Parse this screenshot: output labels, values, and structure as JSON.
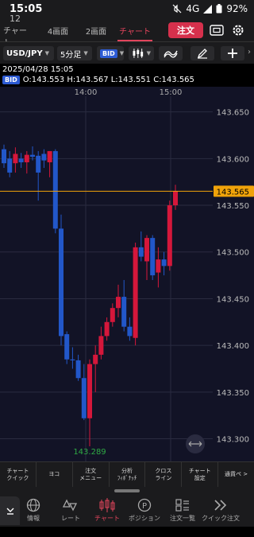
{
  "status": {
    "time": "15:05",
    "network": "4G",
    "battery": "92%"
  },
  "tabs": [
    {
      "num": "12",
      "label": "チャート"
    },
    {
      "label": "4画面"
    },
    {
      "label": "2画面"
    },
    {
      "label": "チャート"
    }
  ],
  "header": {
    "order_label": "注文"
  },
  "toolbar": {
    "pair": "USD/JPY",
    "timeframe": "5分足",
    "price_type": "BID"
  },
  "info": {
    "datetime": "2025/04/28 15:05",
    "badge": "BID",
    "ohlc": "O:143.553 H:143.567 L:143.551 C:143.565"
  },
  "chart_data": {
    "type": "candlestick",
    "time_labels": [
      "14:00",
      "15:00"
    ],
    "y_ticks": [
      "143.650",
      "143.600",
      "143.550",
      "143.500",
      "143.450",
      "143.400",
      "143.350",
      "143.300"
    ],
    "ylim": [
      143.286,
      143.665
    ],
    "current_price": "143.565",
    "low_marker": "143.289",
    "colors": {
      "up": "#d5173b",
      "down": "#2257c9",
      "price_line": "#f0a30a",
      "low_marker": "#2faa44"
    },
    "candles": [
      [
        143.61,
        143.615,
        143.59,
        143.595
      ],
      [
        143.6,
        143.608,
        143.58,
        143.585
      ],
      [
        143.595,
        143.612,
        143.585,
        143.605
      ],
      [
        143.6,
        143.606,
        143.59,
        143.596
      ],
      [
        143.596,
        143.608,
        143.584,
        143.604
      ],
      [
        143.604,
        143.613,
        143.598,
        143.602
      ],
      [
        143.603,
        143.608,
        143.555,
        143.585
      ],
      [
        143.605,
        143.61,
        143.59,
        143.598
      ],
      [
        143.596,
        143.608,
        143.58,
        143.608
      ],
      [
        143.608,
        143.61,
        143.52,
        143.525
      ],
      [
        143.525,
        143.54,
        143.4,
        143.41
      ],
      [
        143.412,
        143.415,
        143.38,
        143.385
      ],
      [
        143.385,
        143.398,
        143.375,
        143.384
      ],
      [
        143.384,
        143.39,
        143.362,
        143.365
      ],
      [
        143.365,
        143.38,
        143.32,
        143.322
      ],
      [
        143.322,
        143.385,
        143.292,
        143.38
      ],
      [
        143.38,
        143.4,
        143.35,
        143.39
      ],
      [
        143.39,
        143.42,
        143.385,
        143.41
      ],
      [
        143.41,
        143.43,
        143.405,
        143.425
      ],
      [
        143.425,
        143.445,
        143.42,
        143.44
      ],
      [
        143.44,
        143.465,
        143.43,
        143.452
      ],
      [
        143.452,
        143.47,
        143.415,
        143.42
      ],
      [
        143.42,
        143.43,
        143.405,
        143.41
      ],
      [
        143.408,
        143.51,
        143.4,
        143.505
      ],
      [
        143.505,
        143.522,
        143.49,
        143.495
      ],
      [
        143.49,
        143.518,
        143.47,
        143.515
      ],
      [
        143.515,
        143.518,
        143.47,
        143.475
      ],
      [
        143.478,
        143.505,
        143.462,
        143.492
      ],
      [
        143.492,
        143.5,
        143.475,
        143.485
      ],
      [
        143.485,
        143.555,
        143.48,
        143.55
      ],
      [
        143.55,
        143.572,
        143.545,
        143.565
      ]
    ]
  },
  "functions": [
    "チャート\nクイック",
    "ヨコ",
    "注文\nメニュー",
    "分析\nﾌｨﾎﾞﾅｯﾁ",
    "クロス\nライン",
    "チャート\n設定",
    "通貨ペ >"
  ],
  "nav": [
    "情報",
    "レート",
    "チャート",
    "ポジション",
    "注文一覧",
    "クイック注文"
  ]
}
